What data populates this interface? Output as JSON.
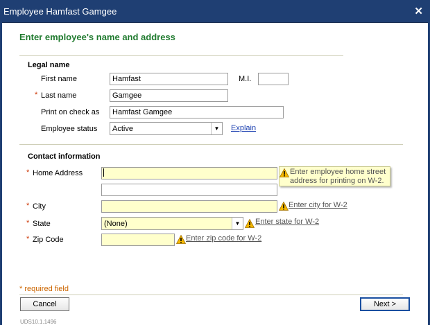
{
  "window": {
    "title": "Employee Hamfast Gamgee",
    "close_glyph": "✕"
  },
  "heading": "Enter employee's name and address",
  "legal": {
    "section_title": "Legal name",
    "first_name_label": "First name",
    "first_name_value": "Hamfast",
    "mi_label": "M.I.",
    "mi_value": "",
    "last_name_label": "Last name",
    "last_name_value": "Gamgee",
    "print_label": "Print on check as",
    "print_value": "Hamfast Gamgee",
    "status_label": "Employee status",
    "status_value": "Active",
    "explain_link": "Explain"
  },
  "contact": {
    "section_title": "Contact information",
    "home_label": "Home Address",
    "home_line1": "",
    "home_line2": "",
    "home_tooltip_line1": "Enter employee home street",
    "home_tooltip_line2": "address for printing on W-2.",
    "city_label": "City",
    "city_value": "",
    "city_hint": "Enter city for W-2",
    "state_label": "State",
    "state_value": "(None)",
    "state_hint": "Enter state for W-2",
    "zip_label": "Zip Code",
    "zip_value": "",
    "zip_hint": "Enter zip code for W-2"
  },
  "required_marker": "*",
  "required_note": "* required field",
  "buttons": {
    "cancel": "Cancel",
    "next": "Next >"
  },
  "version": "UDS10.1.1496",
  "icons": {
    "warning": "warning-icon",
    "dropdown": "chevron-down-icon",
    "close": "close-icon"
  },
  "colors": {
    "title_bar": "#1f3f73",
    "heading": "#1f7a2e",
    "required": "#cc3300",
    "field_highlight": "#ffffcc"
  }
}
